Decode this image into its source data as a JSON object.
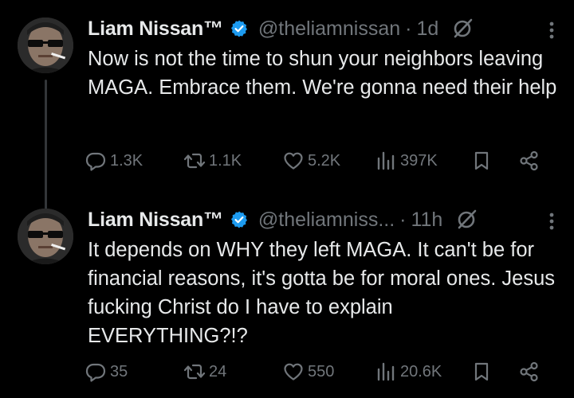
{
  "tweets": [
    {
      "display_name": "Liam Nissan™",
      "handle": "@theliamnissan",
      "separator": "·",
      "time": "1d",
      "text": "Now is not the time to shun your neighbors leaving MAGA. Embrace them. We're gonna need their help",
      "stats": {
        "replies": "1.3K",
        "reposts": "1.1K",
        "likes": "5.2K",
        "views": "397K"
      }
    },
    {
      "display_name": "Liam Nissan™",
      "handle": "@theliamniss...",
      "separator": "·",
      "time": "11h",
      "text": "It depends on WHY they left MAGA. It can't be for financial reasons, it's gotta be for moral ones. Jesus fucking Christ do I have to explain EVERYTHING?!?",
      "stats": {
        "replies": "35",
        "reposts": "24",
        "likes": "550",
        "views": "20.6K"
      }
    }
  ],
  "colors": {
    "background": "#000000",
    "primary_text": "#e7e9ea",
    "secondary_text": "#71767b",
    "verified_blue": "#1d9bf0",
    "thread_line": "#333639"
  },
  "icons": {
    "verified": "verified-badge-icon",
    "grok": "grok-icon",
    "more": "more-options-icon",
    "reply": "reply-icon",
    "repost": "repost-icon",
    "like": "like-icon",
    "views": "views-icon",
    "bookmark": "bookmark-icon",
    "share": "share-icon"
  }
}
